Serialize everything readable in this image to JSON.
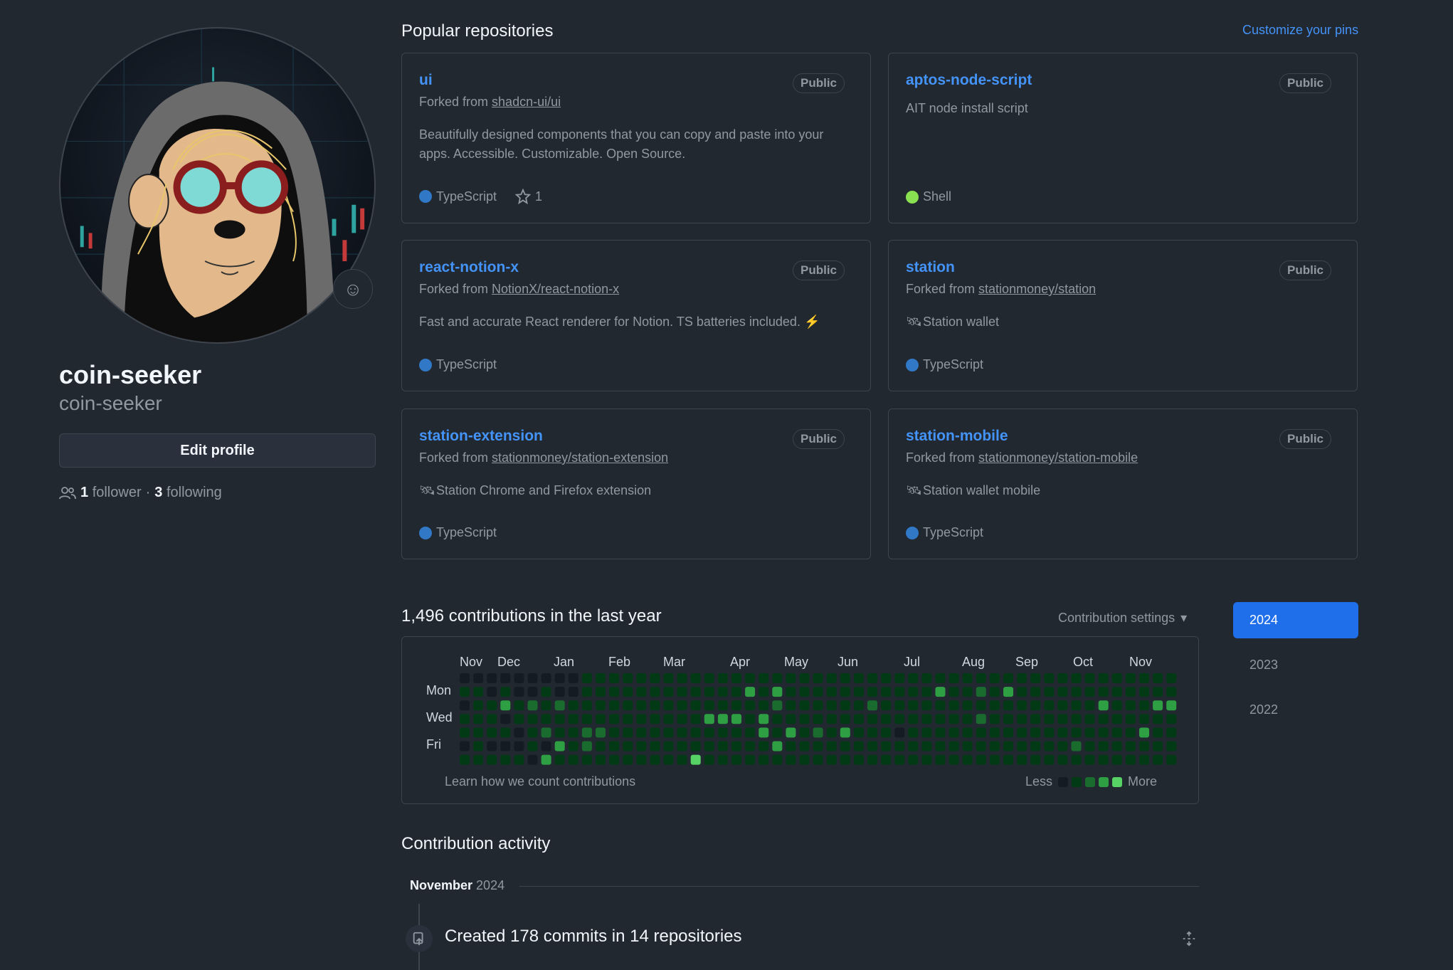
{
  "profile": {
    "display_name": "coin-seeker",
    "username": "coin-seeker",
    "edit_label": "Edit profile",
    "followers_count": "1",
    "followers_label": "follower",
    "separator": "·",
    "following_count": "3",
    "following_label": "following",
    "status_icon": "smiley-icon"
  },
  "pinned": {
    "title": "Popular repositories",
    "customize_label": "Customize your pins",
    "repos": [
      {
        "name": "ui",
        "visibility": "Public",
        "forked_prefix": "Forked from",
        "forked_from": "shadcn-ui/ui",
        "description": "Beautifully designed components that you can copy and paste into your apps. Accessible. Customizable. Open Source.",
        "language": "TypeScript",
        "language_color": "#3178c6",
        "stars": "1"
      },
      {
        "name": "aptos-node-script",
        "visibility": "Public",
        "description": "AIT node install script",
        "language": "Shell",
        "language_color": "#89e051"
      },
      {
        "name": "react-notion-x",
        "visibility": "Public",
        "forked_prefix": "Forked from",
        "forked_from": "NotionX/react-notion-x",
        "description": "Fast and accurate React renderer for Notion. TS batteries included. ⚡️",
        "language": "TypeScript",
        "language_color": "#3178c6"
      },
      {
        "name": "station",
        "visibility": "Public",
        "forked_prefix": "Forked from",
        "forked_from": "stationmoney/station",
        "description": "Station wallet",
        "description_icon": "satellite-icon",
        "language": "TypeScript",
        "language_color": "#3178c6"
      },
      {
        "name": "station-extension",
        "visibility": "Public",
        "forked_prefix": "Forked from",
        "forked_from": "stationmoney/station-extension",
        "description": "Station Chrome and Firefox extension",
        "description_icon": "satellite-icon",
        "language": "TypeScript",
        "language_color": "#3178c6"
      },
      {
        "name": "station-mobile",
        "visibility": "Public",
        "forked_prefix": "Forked from",
        "forked_from": "stationmoney/station-mobile",
        "description": "Station wallet mobile",
        "description_icon": "satellite-icon",
        "language": "TypeScript",
        "language_color": "#3178c6"
      }
    ]
  },
  "contributions": {
    "title": "1,496 contributions in the last year",
    "settings_label": "Contribution settings",
    "months": [
      "Nov",
      "Dec",
      "Jan",
      "Feb",
      "Mar",
      "Apr",
      "May",
      "Jun",
      "Jul",
      "Aug",
      "Sep",
      "Oct",
      "Nov"
    ],
    "day_labels": [
      "Mon",
      "Wed",
      "Fri"
    ],
    "learn_label": "Learn how we count contributions",
    "legend_less": "Less",
    "legend_more": "More",
    "level_colors": [
      "#151b23",
      "#033a16",
      "#196c2e",
      "#2ea043",
      "#56d364"
    ],
    "levels": [
      "0000000001111111111111111111111111111111111111111111112111111",
      "1101001001111111111113131111111111131121311111111111111111114",
      "0113121211111111111111121111112111111111111111131113311111114",
      "1110111111111111113331311111111111111121111111111111111111113",
      "1111012112211111111111313121311101111111111111111131111111213",
      "0100010312111111111111131111111111111111111112111111111131113",
      "1111103111111111141111111111111111111111111111111111111112111"
    ],
    "years": [
      "2024",
      "2023",
      "2022"
    ],
    "active_year": "2024"
  },
  "activity": {
    "title": "Contribution activity",
    "month": "November",
    "year": "2024",
    "commit_summary": "Created 178 commits in 14 repositories"
  }
}
